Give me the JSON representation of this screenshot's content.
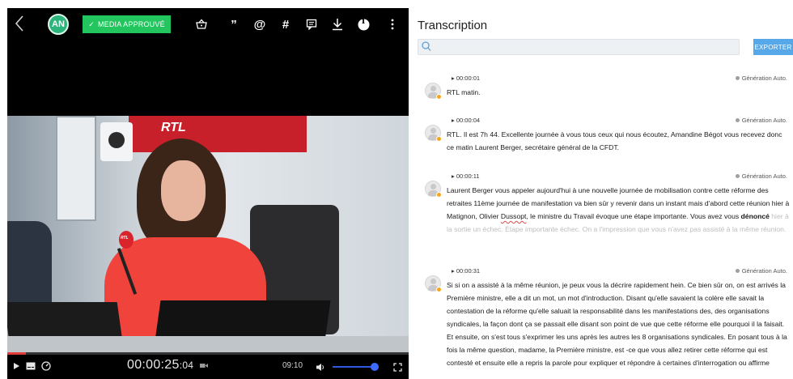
{
  "toolbar": {
    "avatar_initials": "AN",
    "approved_label": "MEDIA APPROUVÉ",
    "icons": [
      "chevron-left-icon",
      "check-icon",
      "basket-icon",
      "quote-icon",
      "at-icon",
      "hashtag-icon",
      "comment-icon",
      "download-icon",
      "info-icon",
      "more-vertical-icon"
    ],
    "quote_glyph": "”",
    "at_glyph": "@",
    "hashtag_glyph": "#",
    "info_glyph": "i"
  },
  "video": {
    "overlay_logo": "RTL",
    "mic_logo": "RTL",
    "progress_fraction": 0.046
  },
  "player": {
    "timecode_main": "00:00:25",
    "timecode_frames": ":04",
    "duration": "09:10",
    "volume_fraction": 0.92
  },
  "transcription": {
    "title": "Transcription",
    "search_placeholder": "",
    "export_label": "EXPORTER",
    "auto_label": "Génération Auto.",
    "segments": [
      {
        "time": "▸ 00:00:01",
        "text": "RTL matin."
      },
      {
        "time": "▸ 00:00:04",
        "text": "RTL. Il est 7h 44. Excellente journée à vous tous ceux qui nous écoutez, Amandine Bégot vous recevez donc ce matin Laurent Berger, secrétaire général de la CFDT."
      },
      {
        "time": "▸ 00:00:11",
        "text_part1": "Laurent Berger vous appeler aujourd'hui à une nouvelle journée de mobilisation contre cette réforme des retraites 11ème journée de manifestation va bien sûr y revenir dans un instant mais d'abord cette réunion hier à Matignon, Olivier ",
        "text_underlined": "Dussopt",
        "text_part2": ", le ministre du Travail évoque une étape importante. Vous avez vous ",
        "text_bold": "dénoncé",
        "text_dim": " hier à la sortie un échec. Étape importante échec. On a l'impression que vous n'avez pas assisté à la même réunion."
      },
      {
        "time": "▸ 00:00:31",
        "text": "Si si on a assisté à la même réunion, je peux vous la décrire rapidement hein. Ce bien sûr on, on est arrivés la Première ministre, elle a dit un mot, un mot d'introduction. Disant qu'elle savaient la colère elle savait la contestation de la réforme qu'elle saluait la responsabilité dans les manifestations des, des organisations syndicales, la façon dont ça se passait elle disant son point de vue que cette réforme elle pourquoi il la faisait. Et ensuite, on s'est tous s'exprimer les uns après les autres les 8 organisations syndicales. En posant tous à la fois la même question, madame, la Première ministre, est -ce que vous allez retirer cette réforme qui est contesté et ensuite elle a repris la parole pour expliquer et répondre à certaines d'interrogation ou affirme"
      }
    ]
  }
}
